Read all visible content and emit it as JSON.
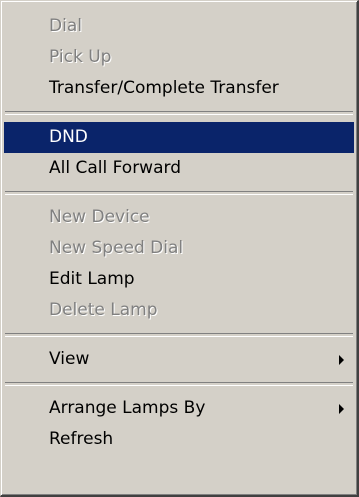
{
  "menu": {
    "groups": [
      [
        {
          "label": "Dial",
          "enabled": false
        },
        {
          "label": "Pick Up",
          "enabled": false
        },
        {
          "label": "Transfer/Complete Transfer",
          "enabled": true
        }
      ],
      [
        {
          "label": "DND",
          "enabled": true,
          "highlighted": true
        },
        {
          "label": "All Call Forward",
          "enabled": true
        }
      ],
      [
        {
          "label": "New Device",
          "enabled": false
        },
        {
          "label": "New Speed Dial",
          "enabled": false
        },
        {
          "label": "Edit Lamp",
          "enabled": true
        },
        {
          "label": "Delete Lamp",
          "enabled": false
        }
      ],
      [
        {
          "label": "View",
          "enabled": true,
          "submenu": true
        }
      ],
      [
        {
          "label": "Arrange Lamps By",
          "enabled": true,
          "submenu": true
        },
        {
          "label": "Refresh",
          "enabled": true
        }
      ]
    ]
  },
  "colors": {
    "menu_background": "#d4d0c8",
    "highlight": "#0a246a",
    "disabled_text": "#808080"
  },
  "icons": {
    "submenu_arrow": "submenu-arrow-icon"
  }
}
